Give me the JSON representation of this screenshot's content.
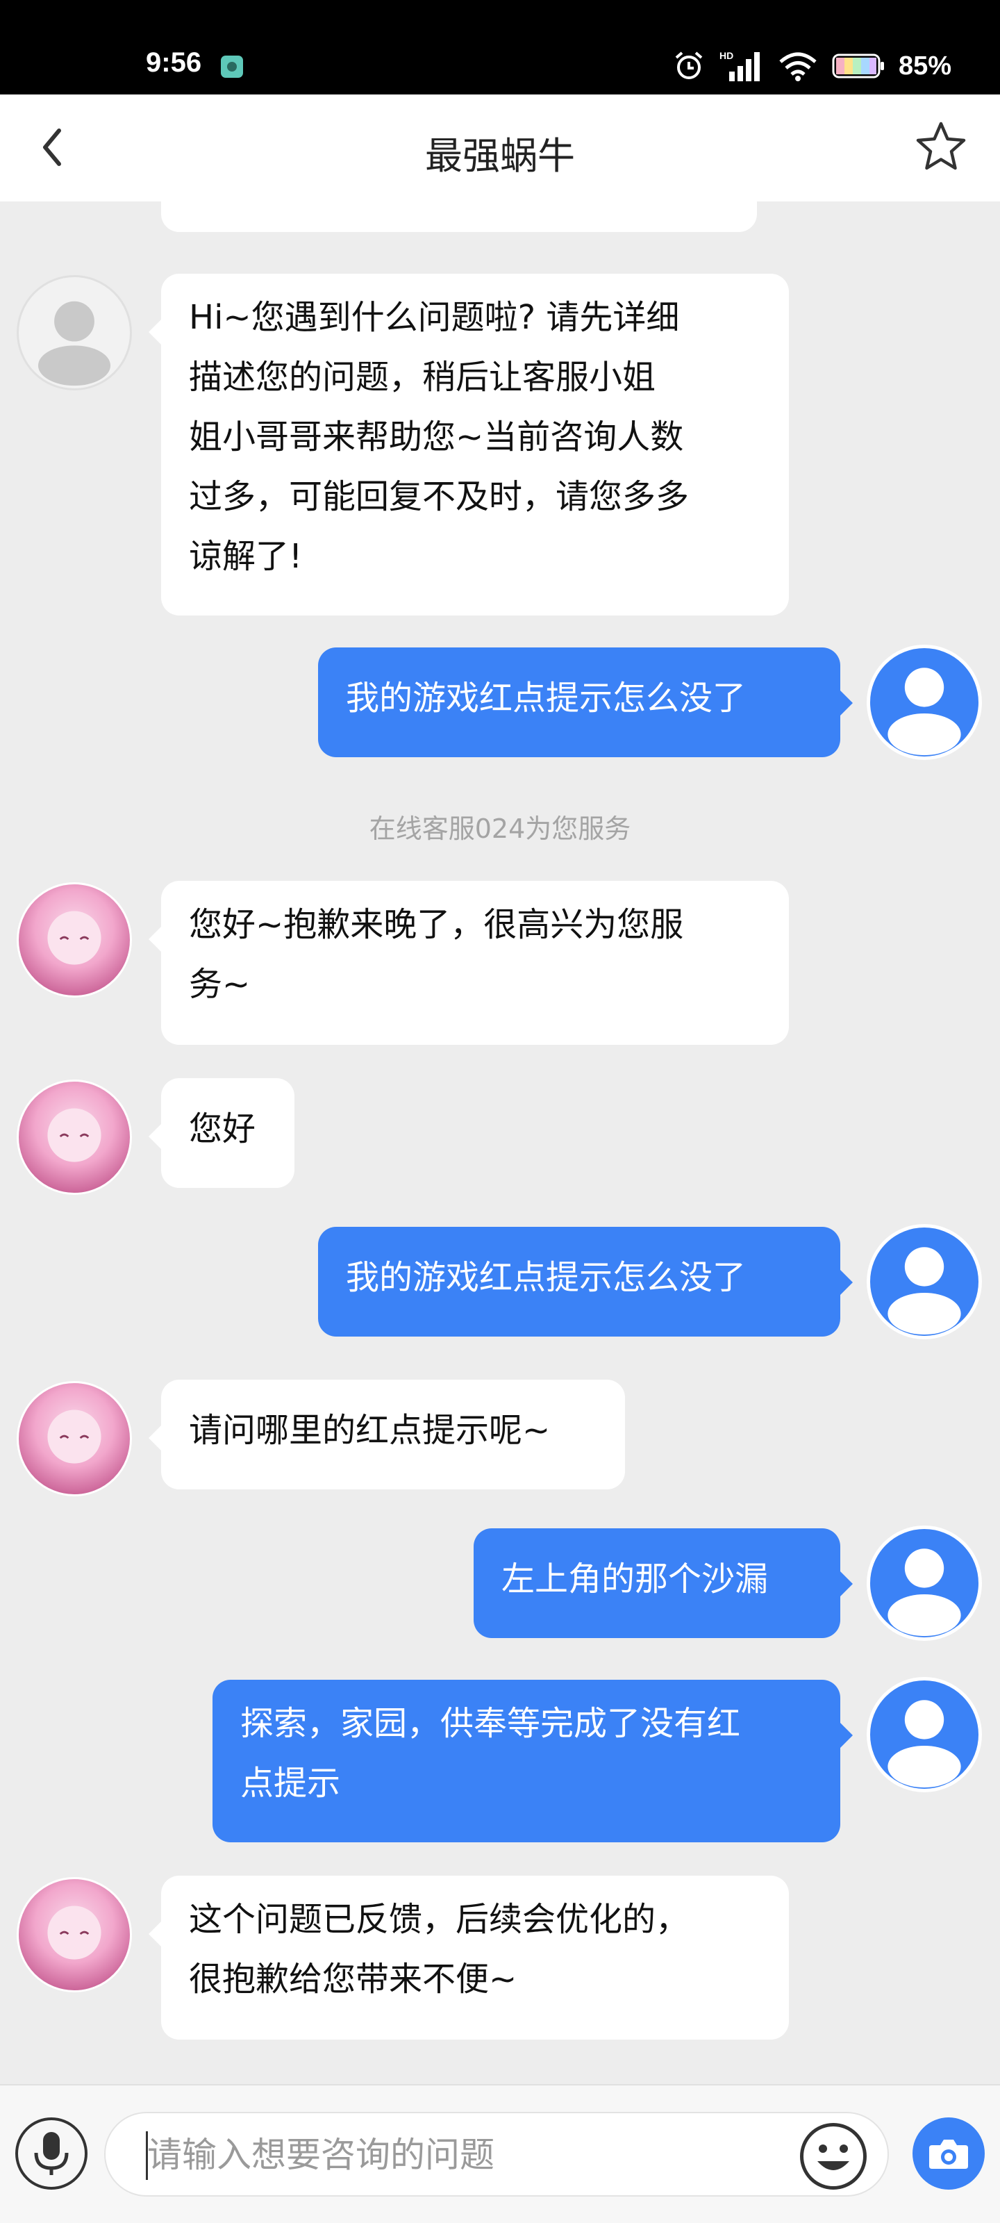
{
  "status_bar": {
    "time": "9:56",
    "battery_percent": "85%"
  },
  "header": {
    "title": "最强蜗牛",
    "back_icon": "chevron-left-icon",
    "favorite_icon": "star-outline-icon"
  },
  "system_message": "在线客服024为您服务",
  "messages": [
    {
      "from": "bot",
      "avatar": "default-avatar",
      "lines": [
        "Hi~您遇到什么问题啦? 请先详细",
        "描述您的问题，稍后让客服小姐",
        "姐小哥哥来帮助您~当前咨询人数",
        "过多，可能回复不及时，请您多多",
        "谅解了!"
      ]
    },
    {
      "from": "user",
      "lines": [
        "我的游戏红点提示怎么没了"
      ]
    },
    {
      "from": "agent",
      "lines": [
        "您好~抱歉来晚了，很高兴为您服",
        "务~"
      ]
    },
    {
      "from": "agent",
      "lines": [
        "您好"
      ]
    },
    {
      "from": "user",
      "lines": [
        "我的游戏红点提示怎么没了"
      ]
    },
    {
      "from": "agent",
      "lines": [
        "请问哪里的红点提示呢~"
      ]
    },
    {
      "from": "user",
      "lines": [
        "左上角的那个沙漏"
      ]
    },
    {
      "from": "user",
      "lines": [
        "探索，家园，供奉等完成了没有红",
        "点提示"
      ]
    },
    {
      "from": "agent",
      "lines": [
        "这个问题已反馈，后续会优化的，",
        "很抱歉给您带来不便~"
      ]
    }
  ],
  "input": {
    "placeholder": "请输入想要咨询的问题",
    "mic_icon": "microphone-icon",
    "emoji_icon": "emoji-icon",
    "camera_icon": "camera-icon"
  },
  "colors": {
    "accent": "#3b82f6",
    "background": "#ededed",
    "bubble_left": "#ffffff"
  }
}
